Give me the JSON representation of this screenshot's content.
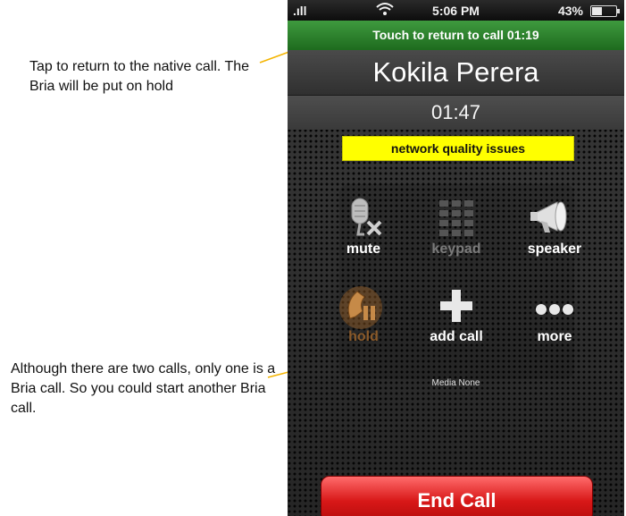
{
  "annotations": [
    "Tap to return to the native call. The Bria will be put on hold",
    "Although there are two calls, only one is a Bria call. So you could start another Bria call."
  ],
  "status_bar": {
    "signal": ".ıll",
    "wifi": "wifi",
    "time": "5:06 PM",
    "battery": "43%",
    "battery_level": 0.43
  },
  "return_bar": {
    "text": "Touch to return to call  01:19"
  },
  "contact": {
    "name": "Kokila Perera"
  },
  "call_duration": "01:47",
  "network_warning": "network quality issues",
  "buttons": [
    {
      "label": "mute",
      "icon": "microphone-muted-icon",
      "state": "active"
    },
    {
      "label": "keypad",
      "icon": "keypad-icon",
      "state": "disabled"
    },
    {
      "label": "speaker",
      "icon": "megaphone-icon",
      "state": "active"
    },
    {
      "label": "hold",
      "icon": "phone-pause-icon",
      "state": "on"
    },
    {
      "label": "add call",
      "icon": "plus-icon",
      "state": "active"
    },
    {
      "label": "more",
      "icon": "ellipsis-icon",
      "state": "active"
    }
  ],
  "media_status": "Media None",
  "end_call_label": "End Call",
  "colors": {
    "return_bar": "#2f8a2f",
    "warning_bg": "#ffff00",
    "end_call": "#d81818",
    "leader_line": "#f4b400",
    "hold_glow": "#c0762a"
  }
}
